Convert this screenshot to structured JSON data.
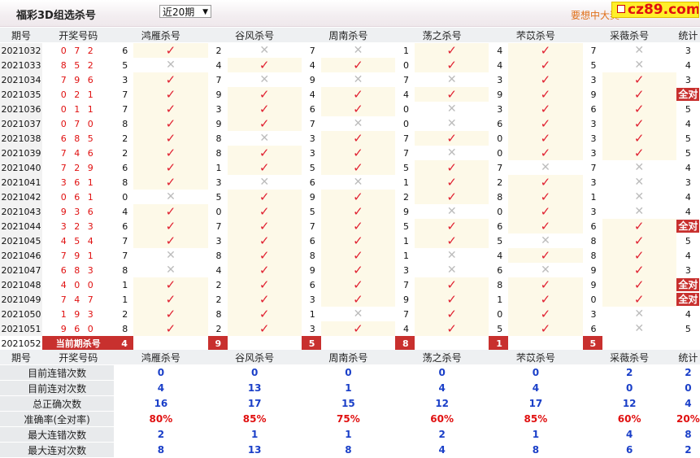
{
  "header": {
    "title": "福彩3D组选杀号",
    "select_value": "近20期",
    "promo_text": "要想中大奖",
    "logo_text": "cz89.com"
  },
  "columns": {
    "period": "期号",
    "numbers": "开奖号码",
    "killers": [
      "鸿雁杀号",
      "谷风杀号",
      "周南杀号",
      "荡之杀号",
      "芣苡杀号",
      "采薇杀号"
    ],
    "stat": "统计"
  },
  "rows": [
    {
      "period": "2021032",
      "nums": "0 7 2",
      "k": [
        [
          "6",
          "ok"
        ],
        [
          "2",
          "no"
        ],
        [
          "7",
          "no"
        ],
        [
          "1",
          "ok"
        ],
        [
          "4",
          "ok"
        ],
        [
          "7",
          "no"
        ]
      ],
      "stat": "3"
    },
    {
      "period": "2021033",
      "nums": "8 5 2",
      "k": [
        [
          "5",
          "no"
        ],
        [
          "4",
          "ok"
        ],
        [
          "4",
          "ok"
        ],
        [
          "0",
          "ok"
        ],
        [
          "4",
          "ok"
        ],
        [
          "5",
          "no"
        ]
      ],
      "stat": "4"
    },
    {
      "period": "2021034",
      "nums": "7 9 6",
      "k": [
        [
          "3",
          "ok"
        ],
        [
          "7",
          "no"
        ],
        [
          "9",
          "no"
        ],
        [
          "7",
          "no"
        ],
        [
          "3",
          "ok"
        ],
        [
          "3",
          "ok"
        ]
      ],
      "stat": "3"
    },
    {
      "period": "2021035",
      "nums": "0 2 1",
      "k": [
        [
          "7",
          "ok"
        ],
        [
          "9",
          "ok"
        ],
        [
          "4",
          "ok"
        ],
        [
          "4",
          "ok"
        ],
        [
          "9",
          "ok"
        ],
        [
          "9",
          "ok"
        ]
      ],
      "stat": "全对"
    },
    {
      "period": "2021036",
      "nums": "0 1 1",
      "k": [
        [
          "7",
          "ok"
        ],
        [
          "3",
          "ok"
        ],
        [
          "6",
          "ok"
        ],
        [
          "0",
          "no"
        ],
        [
          "3",
          "ok"
        ],
        [
          "6",
          "ok"
        ]
      ],
      "stat": "5"
    },
    {
      "period": "2021037",
      "nums": "0 7 0",
      "k": [
        [
          "8",
          "ok"
        ],
        [
          "9",
          "ok"
        ],
        [
          "7",
          "no"
        ],
        [
          "0",
          "no"
        ],
        [
          "6",
          "ok"
        ],
        [
          "3",
          "ok"
        ]
      ],
      "stat": "4"
    },
    {
      "period": "2021038",
      "nums": "6 8 5",
      "k": [
        [
          "2",
          "ok"
        ],
        [
          "8",
          "no"
        ],
        [
          "3",
          "ok"
        ],
        [
          "7",
          "ok"
        ],
        [
          "0",
          "ok"
        ],
        [
          "3",
          "ok"
        ]
      ],
      "stat": "5"
    },
    {
      "period": "2021039",
      "nums": "7 4 6",
      "k": [
        [
          "2",
          "ok"
        ],
        [
          "8",
          "ok"
        ],
        [
          "3",
          "ok"
        ],
        [
          "7",
          "no"
        ],
        [
          "0",
          "ok"
        ],
        [
          "3",
          "ok"
        ]
      ],
      "stat": "5"
    },
    {
      "period": "2021040",
      "nums": "7 2 9",
      "k": [
        [
          "6",
          "ok"
        ],
        [
          "1",
          "ok"
        ],
        [
          "5",
          "ok"
        ],
        [
          "5",
          "ok"
        ],
        [
          "7",
          "no"
        ],
        [
          "7",
          "no"
        ]
      ],
      "stat": "4"
    },
    {
      "period": "2021041",
      "nums": "3 6 1",
      "k": [
        [
          "8",
          "ok"
        ],
        [
          "3",
          "no"
        ],
        [
          "6",
          "no"
        ],
        [
          "1",
          "ok"
        ],
        [
          "2",
          "ok"
        ],
        [
          "3",
          "no"
        ]
      ],
      "stat": "3"
    },
    {
      "period": "2021042",
      "nums": "0 6 1",
      "k": [
        [
          "0",
          "no"
        ],
        [
          "5",
          "ok"
        ],
        [
          "9",
          "ok"
        ],
        [
          "2",
          "ok"
        ],
        [
          "8",
          "ok"
        ],
        [
          "1",
          "no"
        ]
      ],
      "stat": "4"
    },
    {
      "period": "2021043",
      "nums": "9 3 6",
      "k": [
        [
          "4",
          "ok"
        ],
        [
          "0",
          "ok"
        ],
        [
          "5",
          "ok"
        ],
        [
          "9",
          "no"
        ],
        [
          "0",
          "ok"
        ],
        [
          "3",
          "no"
        ]
      ],
      "stat": "4"
    },
    {
      "period": "2021044",
      "nums": "3 2 3",
      "k": [
        [
          "6",
          "ok"
        ],
        [
          "7",
          "ok"
        ],
        [
          "7",
          "ok"
        ],
        [
          "5",
          "ok"
        ],
        [
          "6",
          "ok"
        ],
        [
          "6",
          "ok"
        ]
      ],
      "stat": "全对"
    },
    {
      "period": "2021045",
      "nums": "4 5 4",
      "k": [
        [
          "7",
          "ok"
        ],
        [
          "3",
          "ok"
        ],
        [
          "6",
          "ok"
        ],
        [
          "1",
          "ok"
        ],
        [
          "5",
          "no"
        ],
        [
          "8",
          "ok"
        ]
      ],
      "stat": "5"
    },
    {
      "period": "2021046",
      "nums": "7 9 1",
      "k": [
        [
          "7",
          "no"
        ],
        [
          "8",
          "ok"
        ],
        [
          "8",
          "ok"
        ],
        [
          "1",
          "no"
        ],
        [
          "4",
          "ok"
        ],
        [
          "8",
          "ok"
        ]
      ],
      "stat": "4"
    },
    {
      "period": "2021047",
      "nums": "6 8 3",
      "k": [
        [
          "8",
          "no"
        ],
        [
          "4",
          "ok"
        ],
        [
          "9",
          "ok"
        ],
        [
          "3",
          "no"
        ],
        [
          "6",
          "no"
        ],
        [
          "9",
          "ok"
        ]
      ],
      "stat": "3"
    },
    {
      "period": "2021048",
      "nums": "4 0 0",
      "k": [
        [
          "1",
          "ok"
        ],
        [
          "2",
          "ok"
        ],
        [
          "6",
          "ok"
        ],
        [
          "7",
          "ok"
        ],
        [
          "8",
          "ok"
        ],
        [
          "9",
          "ok"
        ]
      ],
      "stat": "全对"
    },
    {
      "period": "2021049",
      "nums": "7 4 7",
      "k": [
        [
          "1",
          "ok"
        ],
        [
          "2",
          "ok"
        ],
        [
          "3",
          "ok"
        ],
        [
          "9",
          "ok"
        ],
        [
          "1",
          "ok"
        ],
        [
          "0",
          "ok"
        ]
      ],
      "stat": "全对"
    },
    {
      "period": "2021050",
      "nums": "1 9 3",
      "k": [
        [
          "2",
          "ok"
        ],
        [
          "8",
          "ok"
        ],
        [
          "1",
          "no"
        ],
        [
          "7",
          "ok"
        ],
        [
          "0",
          "ok"
        ],
        [
          "3",
          "no"
        ]
      ],
      "stat": "4"
    },
    {
      "period": "2021051",
      "nums": "9 6 0",
      "k": [
        [
          "8",
          "ok"
        ],
        [
          "2",
          "ok"
        ],
        [
          "3",
          "ok"
        ],
        [
          "4",
          "ok"
        ],
        [
          "5",
          "ok"
        ],
        [
          "6",
          "no"
        ]
      ],
      "stat": "5"
    }
  ],
  "current": {
    "period": "2021052",
    "label": "当前期杀号",
    "picks": [
      "4",
      "9",
      "5",
      "8",
      "1",
      "5"
    ]
  },
  "summary": {
    "rows": [
      {
        "label": "目前连错次数",
        "values": [
          "0",
          "0",
          "0",
          "0",
          "0",
          "2"
        ],
        "total": "2",
        "style": "v"
      },
      {
        "label": "目前连对次数",
        "values": [
          "4",
          "13",
          "1",
          "4",
          "4",
          "0"
        ],
        "total": "0",
        "style": "v"
      },
      {
        "label": "总正确次数",
        "values": [
          "16",
          "17",
          "15",
          "12",
          "17",
          "12"
        ],
        "total": "4",
        "style": "v"
      },
      {
        "label": "准确率(全对率)",
        "values": [
          "80%",
          "85%",
          "75%",
          "60%",
          "85%",
          "60%"
        ],
        "total": "20%",
        "style": "r"
      },
      {
        "label": "最大连错次数",
        "values": [
          "2",
          "1",
          "1",
          "2",
          "1",
          "4"
        ],
        "total": "8",
        "style": "v"
      },
      {
        "label": "最大连对次数",
        "values": [
          "8",
          "13",
          "8",
          "4",
          "8",
          "6"
        ],
        "total": "2",
        "style": "v"
      }
    ]
  },
  "icons": {
    "ok": "check-icon",
    "no": "cross-icon"
  },
  "colors": {
    "accent": "#c8302e",
    "check": "#e02030",
    "cross": "#bcbcbc",
    "highlight": "#fdf9e8",
    "value_blue": "#1a3fc8"
  }
}
